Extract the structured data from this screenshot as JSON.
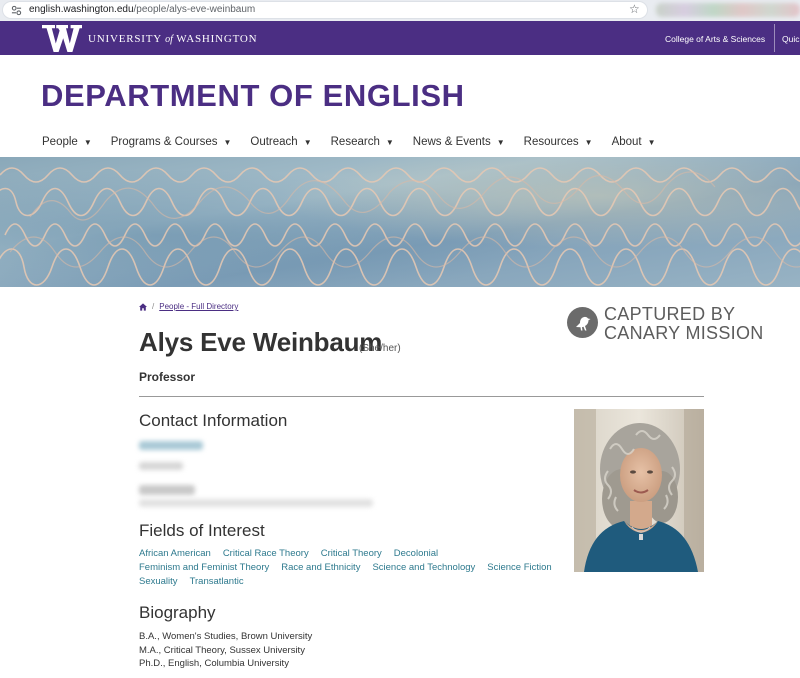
{
  "browser": {
    "url_host": "english.washington.edu",
    "url_path": "/people/alys-eve-weinbaum"
  },
  "uw_bar": {
    "university_pre": "UNIVERSITY",
    "university_of": "of",
    "university_post": "WASHINGTON",
    "college_link": "College of Arts & Sciences",
    "quick_link": "Quic"
  },
  "department": {
    "title": "DEPARTMENT OF ENGLISH"
  },
  "nav": {
    "items": [
      "People",
      "Programs & Courses",
      "Outreach",
      "Research",
      "News & Events",
      "Resources",
      "About"
    ]
  },
  "breadcrumb": {
    "link": "People - Full Directory"
  },
  "watermark": {
    "line1": "CAPTURED BY",
    "line2": "CANARY MISSION"
  },
  "profile": {
    "name": "Alys Eve Weinbaum",
    "pronouns": "(She/her)",
    "title": "Professor"
  },
  "sections": {
    "contact": "Contact Information",
    "fields": "Fields of Interest",
    "biography": "Biography"
  },
  "fields_of_interest": {
    "row1": [
      "African American",
      "Critical Race Theory",
      "Critical Theory",
      "Decolonial"
    ],
    "row2": [
      "Feminism and Feminist Theory",
      "Race and Ethnicity",
      "Science and Technology",
      "Science Fiction"
    ],
    "row3": [
      "Sexuality",
      "Transatlantic"
    ]
  },
  "biography": {
    "degrees": [
      "B.A., Women's Studies, Brown University",
      "M.A., Critical Theory, Sussex University",
      "Ph.D., English, Columbia University"
    ]
  },
  "colors": {
    "uw_purple": "#4b2e83",
    "link_teal": "#2e7a8e"
  }
}
